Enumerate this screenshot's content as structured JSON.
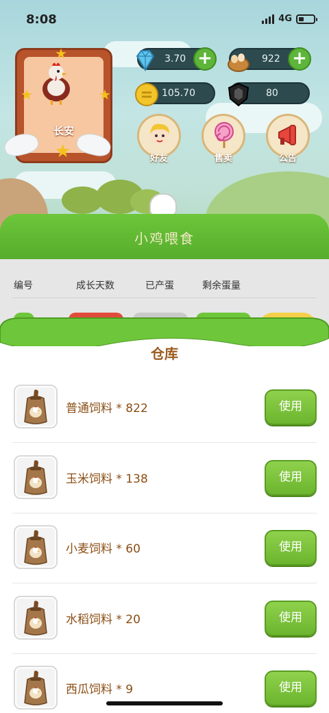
{
  "status_bar": {
    "time": "8:08",
    "network": "4G"
  },
  "profile": {
    "name": "长安"
  },
  "resources": {
    "diamond": "3.70",
    "eggs": "922",
    "coins": "105.70",
    "points": "80"
  },
  "menu": {
    "friends_label": "好友",
    "sell_label": "售卖",
    "notice_label": "公告"
  },
  "feeding_panel": {
    "title": "小鸡喂食",
    "columns": [
      "编号",
      "成长天数",
      "已产蛋",
      "剩余蛋量"
    ]
  },
  "warehouse": {
    "title": "仓库",
    "items": [
      {
        "label": "普通饲料 * 822",
        "button": "使用"
      },
      {
        "label": "玉米饲料 * 138",
        "button": "使用"
      },
      {
        "label": "小麦饲料 * 60",
        "button": "使用"
      },
      {
        "label": "水稻饲料 * 20",
        "button": "使用"
      },
      {
        "label": "西瓜饲料 * 9",
        "button": "使用"
      }
    ]
  },
  "colors": {
    "accent_green": "#6cb52e",
    "label_brown": "#8b4e14",
    "title_brown": "#9a5a1c"
  }
}
